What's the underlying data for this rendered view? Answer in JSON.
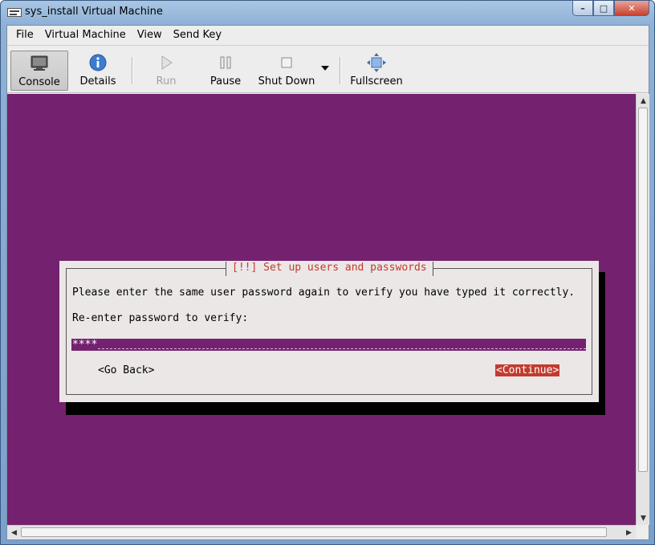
{
  "window": {
    "title": "sys_install Virtual Machine",
    "controls": {
      "minimize": "–",
      "maximize": "□",
      "close": "✕"
    }
  },
  "menubar": {
    "items": [
      "File",
      "Virtual Machine",
      "View",
      "Send Key"
    ]
  },
  "toolbar": {
    "console": "Console",
    "details": "Details",
    "run": "Run",
    "pause": "Pause",
    "shutdown": "Shut Down",
    "fullscreen": "Fullscreen"
  },
  "installer": {
    "title": "[!!] Set up users and passwords",
    "message": "Please enter the same user password again to verify you have typed it correctly.",
    "prompt": "Re-enter password to verify:",
    "password_value": "****",
    "go_back": "<Go Back>",
    "continue": "<Continue>"
  },
  "colors": {
    "console_bg": "#74226f",
    "accent": "#c23b2f",
    "dialog_bg": "#ebe7e7"
  }
}
